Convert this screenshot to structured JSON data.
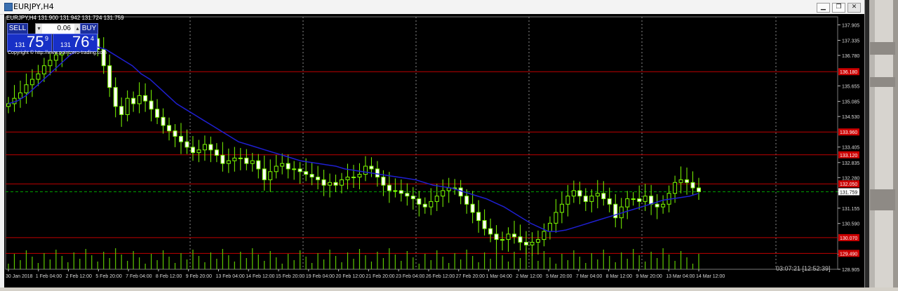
{
  "window": {
    "title": "EURJPY,H4",
    "buttons": {
      "minimize": "▁",
      "restore": "❐",
      "close": "✕"
    }
  },
  "chart_header": {
    "symbol_line": "EURJPY,H4  131.900 131.942 131.724 131.759"
  },
  "trade_panel": {
    "sell_label": "SELL",
    "buy_label": "BUY",
    "lot_value": "0.06",
    "sell_price": {
      "prefix": "131",
      "main": "75",
      "superscript": "9"
    },
    "buy_price": {
      "prefix": "131",
      "main": "76",
      "superscript": "4"
    }
  },
  "copyright": "Copyright © http://www.pointzero-trading.com",
  "countdown": "03:07:21 [12:52:39]",
  "colors": {
    "background": "#000000",
    "grid": "#8a8a8a",
    "candle": "#7cfc00",
    "ma_line": "#1f1fd0",
    "level_line": "#c00000",
    "current_price": "#00a000"
  },
  "chart_data": {
    "type": "candlestick",
    "symbol": "EURJPY",
    "timeframe": "H4",
    "last_price": 131.759,
    "ylim": [
      128.905,
      138.2
    ],
    "y_ticks": [
      "137.905",
      "137.335",
      "136.780",
      "135.655",
      "135.085",
      "134.530",
      "133.405",
      "132.835",
      "132.280",
      "131.759",
      "131.155",
      "130.590",
      "129.460",
      "128.905"
    ],
    "x_ticks": [
      "30 Jan 2018",
      "1 Feb 04:00",
      "2 Feb 12:00",
      "5 Feb 20:00",
      "7 Feb 04:00",
      "8 Feb 12:00",
      "9 Feb 20:00",
      "13 Feb 04:00",
      "14 Feb 12:00",
      "15 Feb 20:00",
      "19 Feb 04:00",
      "20 Feb 12:00",
      "21 Feb 20:00",
      "23 Feb 04:00",
      "26 Feb 12:00",
      "27 Feb 20:00",
      "1 Mar 04:00",
      "2 Mar 12:00",
      "5 Mar 20:00",
      "7 Mar 04:00",
      "8 Mar 12:00",
      "9 Mar 20:00",
      "13 Mar 04:00",
      "14 Mar 12:00"
    ],
    "level_lines": [
      {
        "price": 136.18,
        "label": "136.180"
      },
      {
        "price": 133.96,
        "label": "133.960"
      },
      {
        "price": 133.12,
        "label": "133.120"
      },
      {
        "price": 132.05,
        "label": "132.050"
      },
      {
        "price": 130.07,
        "label": "130.070"
      },
      {
        "price": 129.49,
        "label": "129.490"
      }
    ],
    "close_series": [
      135.0,
      135.2,
      135.4,
      135.7,
      135.9,
      136.1,
      136.4,
      136.6,
      136.8,
      137.0,
      137.2,
      137.4,
      137.5,
      137.6,
      137.4,
      137.0,
      136.4,
      135.6,
      134.9,
      134.6,
      135.2,
      135.0,
      135.3,
      135.1,
      134.8,
      134.5,
      134.2,
      134.0,
      133.8,
      133.6,
      133.4,
      133.2,
      133.3,
      133.5,
      133.3,
      133.1,
      132.8,
      132.9,
      133.0,
      133.0,
      132.8,
      132.9,
      132.6,
      132.2,
      132.5,
      132.7,
      132.8,
      132.6,
      132.6,
      132.5,
      132.4,
      132.3,
      132.2,
      132.0,
      132.1,
      132.0,
      132.2,
      132.3,
      132.3,
      132.4,
      132.7,
      132.6,
      132.3,
      132.0,
      131.8,
      131.8,
      131.7,
      131.6,
      131.5,
      131.3,
      131.2,
      131.4,
      131.6,
      131.8,
      131.9,
      131.9,
      131.6,
      131.3,
      131.0,
      130.7,
      130.4,
      130.2,
      130.0,
      130.0,
      130.2,
      130.1,
      129.9,
      129.8,
      129.9,
      130.0,
      130.3,
      130.6,
      131.0,
      131.3,
      131.6,
      131.8,
      131.6,
      131.4,
      131.6,
      131.7,
      131.5,
      131.3,
      130.8,
      131.2,
      131.5,
      131.5,
      131.4,
      131.6,
      131.3,
      131.2,
      131.3,
      131.7,
      132.1,
      132.2,
      132.1,
      131.9,
      131.76
    ],
    "ma_series": [
      135.0,
      135.1,
      135.3,
      135.6,
      135.9,
      136.2,
      136.5,
      136.8,
      137.0,
      137.1,
      137.1,
      137.0,
      136.8,
      136.6,
      136.4,
      136.1,
      135.9,
      135.6,
      135.3,
      135.0,
      134.8,
      134.6,
      134.4,
      134.2,
      134.0,
      133.8,
      133.6,
      133.5,
      133.4,
      133.3,
      133.2,
      133.1,
      133.0,
      132.9,
      132.85,
      132.8,
      132.75,
      132.7,
      132.6,
      132.55,
      132.5,
      132.45,
      132.4,
      132.35,
      132.3,
      132.25,
      132.2,
      132.1,
      132.0,
      131.95,
      131.9,
      131.8,
      131.7,
      131.6,
      131.5,
      131.35,
      131.2,
      131.0,
      130.8,
      130.6,
      130.45,
      130.3,
      130.3,
      130.35,
      130.45,
      130.55,
      130.65,
      130.75,
      130.85,
      130.95,
      131.05,
      131.15,
      131.25,
      131.35,
      131.45,
      131.5,
      131.55,
      131.6,
      131.7
    ]
  }
}
